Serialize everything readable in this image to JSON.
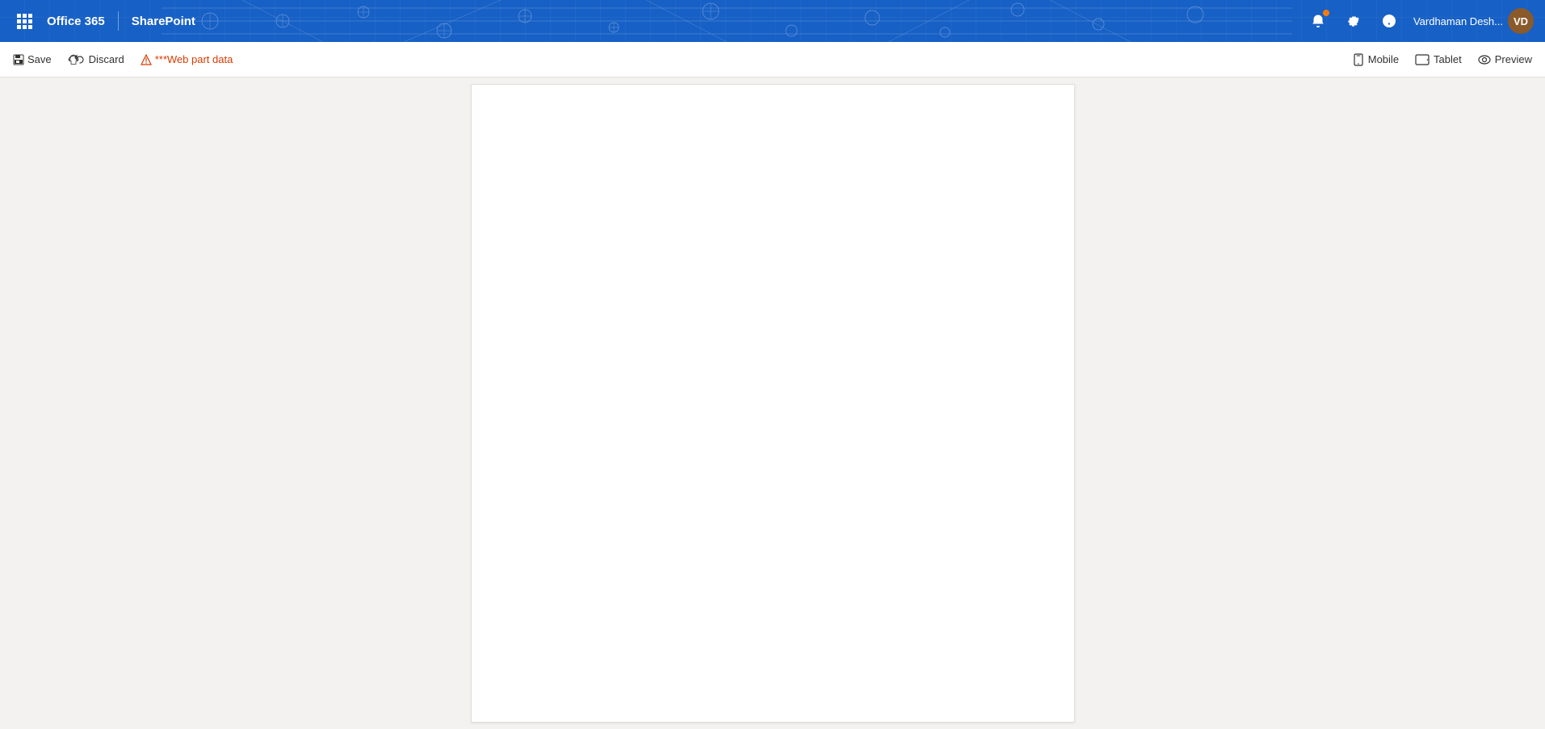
{
  "header": {
    "app_name": "Office 365",
    "divider": "|",
    "product_name": "SharePoint"
  },
  "nav_icons": {
    "waffle": "⠿",
    "bell_label": "Notifications",
    "gear_label": "Settings",
    "help_label": "Help"
  },
  "user": {
    "name": "Vardhaman Desh...",
    "initials": "VD"
  },
  "toolbar": {
    "save_label": "Save",
    "discard_label": "Discard",
    "warning_label": "***Web part data"
  },
  "toolbar_right": {
    "mobile_label": "Mobile",
    "tablet_label": "Tablet",
    "preview_label": "Preview"
  },
  "page": {
    "canvas_empty": true
  }
}
